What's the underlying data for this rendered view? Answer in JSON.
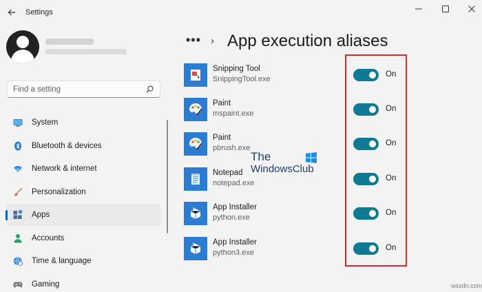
{
  "window": {
    "title": "Settings",
    "controls": {
      "minimize": "—",
      "maximize": "☐",
      "close": "✕"
    }
  },
  "search": {
    "placeholder": "Find a setting"
  },
  "sidebar": {
    "items": [
      {
        "label": "System",
        "icon": "monitor-icon",
        "active": false
      },
      {
        "label": "Bluetooth & devices",
        "icon": "bluetooth-icon",
        "active": false
      },
      {
        "label": "Network & internet",
        "icon": "wifi-icon",
        "active": false
      },
      {
        "label": "Personalization",
        "icon": "brush-icon",
        "active": false
      },
      {
        "label": "Apps",
        "icon": "apps-icon",
        "active": true
      },
      {
        "label": "Accounts",
        "icon": "person-icon",
        "active": false
      },
      {
        "label": "Time & language",
        "icon": "globe-clock-icon",
        "active": false
      },
      {
        "label": "Gaming",
        "icon": "gamepad-icon",
        "active": false
      }
    ]
  },
  "header": {
    "breadcrumb_more": "•••",
    "chevron": "›",
    "title": "App execution aliases"
  },
  "aliases": [
    {
      "name": "Snipping Tool",
      "exe": "SnippingTool.exe",
      "state": "On",
      "icon": "snipping-tool-icon"
    },
    {
      "name": "Paint",
      "exe": "mspaint.exe",
      "state": "On",
      "icon": "paint-palette-icon"
    },
    {
      "name": "Paint",
      "exe": "pbrush.exe",
      "state": "On",
      "icon": "paint-palette-icon"
    },
    {
      "name": "Notepad",
      "exe": "notepad.exe",
      "state": "On",
      "icon": "notepad-icon"
    },
    {
      "name": "App Installer",
      "exe": "python.exe",
      "state": "On",
      "icon": "package-icon"
    },
    {
      "name": "App Installer",
      "exe": "python3.exe",
      "state": "On",
      "icon": "package-icon"
    }
  ],
  "watermark": {
    "line1": "The",
    "line2": "WindowsClub"
  },
  "footer_watermark": "wsxdn.com",
  "colors": {
    "accent": "#0067c0",
    "toggle_on": "#0f7a94",
    "highlight": "#d8282c",
    "tile": "#2c7cd4"
  }
}
